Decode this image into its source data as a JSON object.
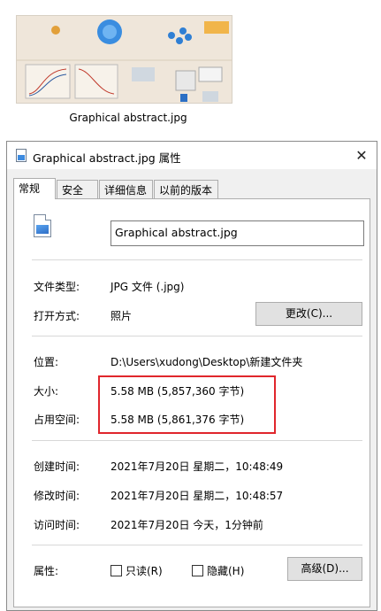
{
  "thumbnail": {
    "caption": "Graphical  abstract.jpg"
  },
  "dialog": {
    "title": "Graphical  abstract.jpg 属性",
    "close_glyph": "✕",
    "tabs": [
      {
        "label": "常规"
      },
      {
        "label": "安全"
      },
      {
        "label": "详细信息"
      },
      {
        "label": "以前的版本"
      }
    ],
    "file_name": "Graphical  abstract.jpg",
    "type_label": "文件类型:",
    "type_value": "JPG 文件 (.jpg)",
    "opens_with_label": "打开方式:",
    "opens_with_value": "照片",
    "change_button": "更改(C)...",
    "location_label": "位置:",
    "location_value": "D:\\Users\\xudong\\Desktop\\新建文件夹",
    "size_label": "大小:",
    "size_value": "5.58 MB (5,857,360 字节)",
    "size_on_disk_label": "占用空间:",
    "size_on_disk_value": "5.58 MB (5,861,376 字节)",
    "created_label": "创建时间:",
    "created_value": "2021年7月20日 星期二，10:48:49",
    "modified_label": "修改时间:",
    "modified_value": "2021年7月20日 星期二，10:48:57",
    "accessed_label": "访问时间:",
    "accessed_value": "2021年7月20日 今天，1分钟前",
    "attributes_label": "属性:",
    "readonly_label": "只读(R)",
    "hidden_label": "隐藏(H)",
    "advanced_button": "高级(D)...",
    "highlight_color": "#e0262c"
  }
}
